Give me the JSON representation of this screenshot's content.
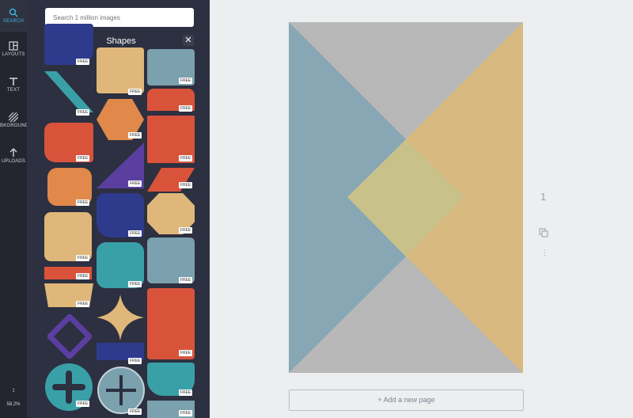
{
  "sidebar": {
    "items": [
      {
        "label": "SEARCH",
        "icon": "search-icon"
      },
      {
        "label": "LAYOUTS",
        "icon": "layouts-icon"
      },
      {
        "label": "TEXT",
        "icon": "text-icon"
      },
      {
        "label": "BKGROUND",
        "icon": "background-icon"
      },
      {
        "label": "UPLOADS",
        "icon": "upload-icon"
      }
    ],
    "zoom_level": "58.2%",
    "zoom_icon": "zoom-icon"
  },
  "panel": {
    "search_placeholder": "Search 1 million images",
    "tab_label": "Shapes",
    "free_badge": "FREE",
    "colors": {
      "navy": "#2e3a8c",
      "teal": "#3aa0a8",
      "orange": "#d9533b",
      "peach": "#e0b77a",
      "slate": "#7aa1ad",
      "purple": "#5a3fa0"
    }
  },
  "canvas": {
    "add_page_label": "+ Add a new page",
    "page_number": "1",
    "colors": {
      "blue": "#88a7b5",
      "tan": "#d8b97f",
      "gray": "#b8b8b8",
      "center": "#c9c18a"
    }
  }
}
